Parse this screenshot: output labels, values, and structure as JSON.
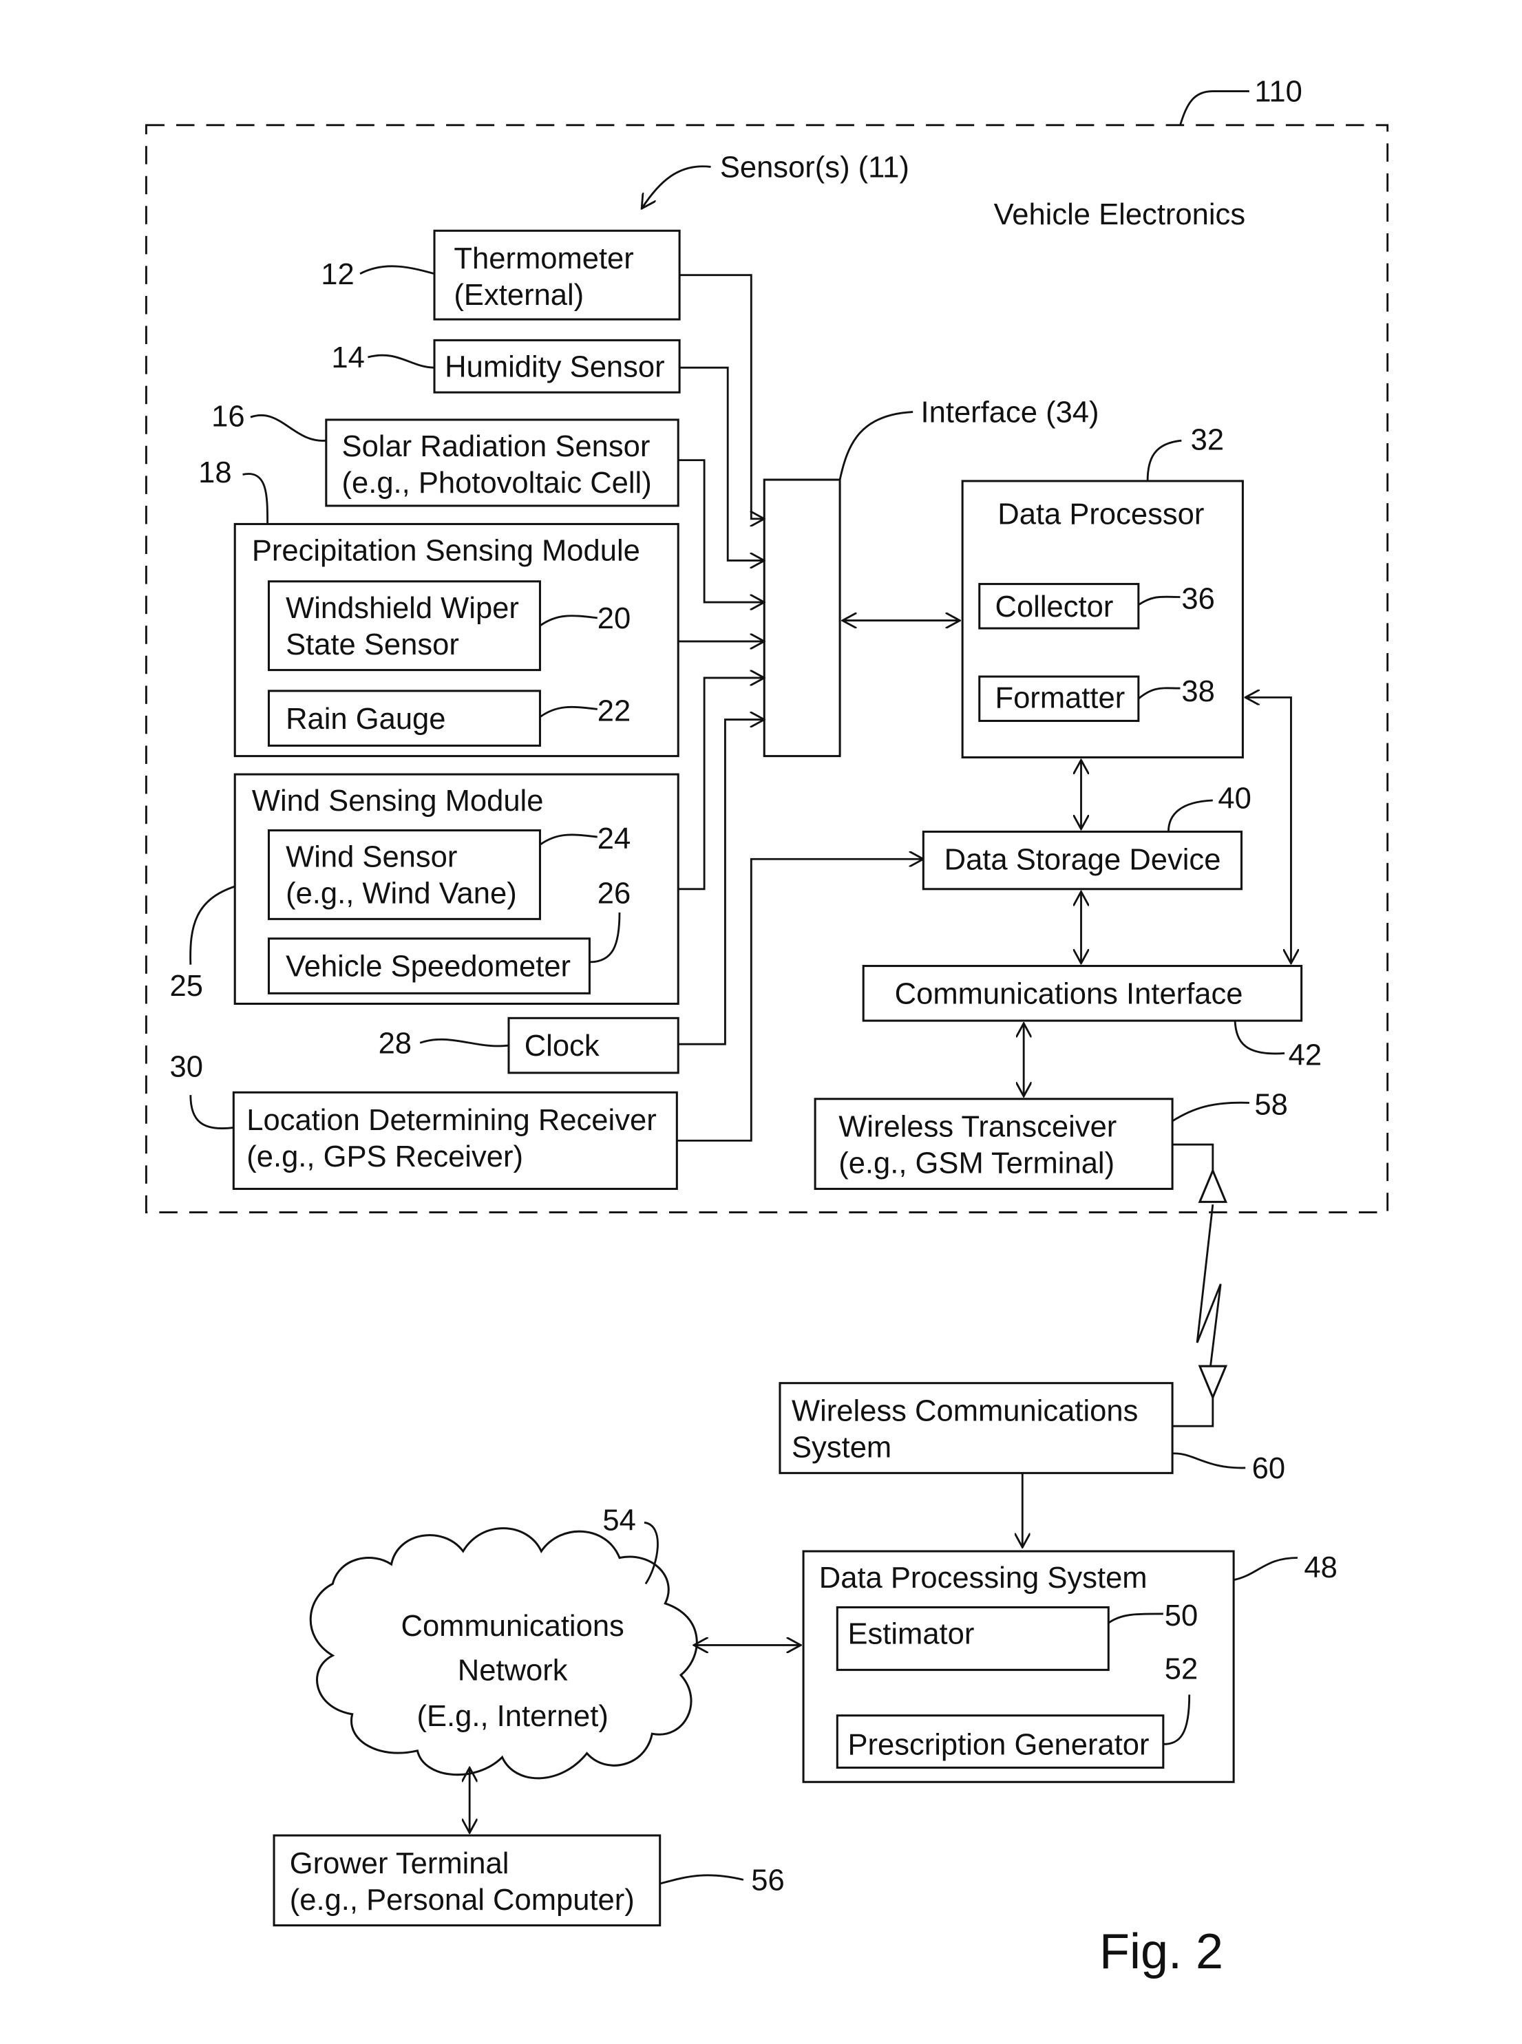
{
  "figure_label": "Fig. 2",
  "refs": {
    "r110": "110",
    "r11": "Sensor(s) (11)",
    "r12": "12",
    "r14": "14",
    "r16": "16",
    "r18": "18",
    "r20": "20",
    "r22": "22",
    "r24": "24",
    "r25": "25",
    "r26": "26",
    "r28": "28",
    "r30": "30",
    "r32": "32",
    "r34": "Interface (34)",
    "r36": "36",
    "r38": "38",
    "r40": "40",
    "r42": "42",
    "r48": "48",
    "r50": "50",
    "r52": "52",
    "r54": "54",
    "r56": "56",
    "r58": "58",
    "r60": "60"
  },
  "vehicle": {
    "title": "Vehicle Electronics",
    "thermometer": [
      "Thermometer",
      "(External)"
    ],
    "humidity": "Humidity Sensor",
    "solar": [
      "Solar Radiation Sensor",
      "(e.g., Photovoltaic Cell)"
    ],
    "precip_module": "Precipitation Sensing Module",
    "wiper": [
      "Windshield Wiper",
      "State Sensor"
    ],
    "rain": "Rain Gauge",
    "wind_module": "Wind Sensing Module",
    "wind_sensor": [
      "Wind Sensor",
      "(e.g., Wind Vane)"
    ],
    "speedometer": "Vehicle Speedometer",
    "clock": "Clock",
    "location": [
      "Location Determining Receiver",
      "(e.g., GPS Receiver)"
    ],
    "data_processor": "Data Processor",
    "collector": "Collector",
    "formatter": "Formatter",
    "storage": "Data Storage Device",
    "comm_interface": "Communications Interface",
    "transceiver": [
      "Wireless Transceiver",
      "(e.g., GSM Terminal)"
    ]
  },
  "remote": {
    "wireless_system": [
      "Wireless Communications",
      "System"
    ],
    "dps": "Data Processing System",
    "estimator": "Estimator",
    "prescription": "Prescription Generator",
    "network": [
      "Communications",
      "Network",
      "(E.g., Internet)"
    ],
    "grower": [
      "Grower Terminal",
      "(e.g., Personal Computer)"
    ]
  }
}
